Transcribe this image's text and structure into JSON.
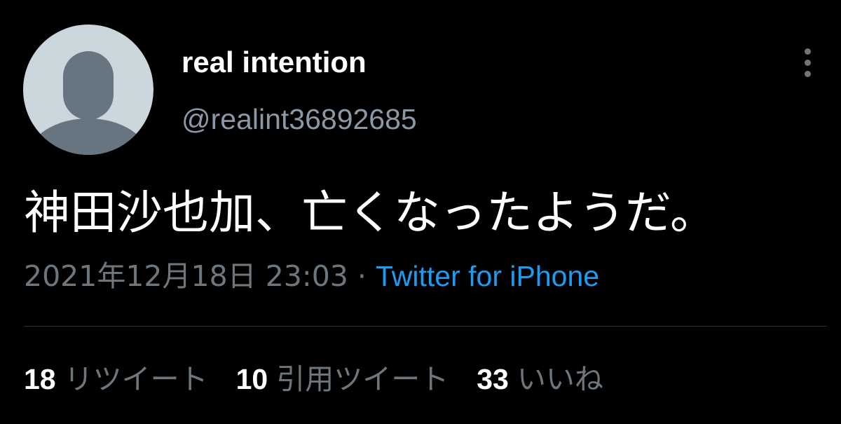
{
  "user": {
    "display_name": "real intention",
    "handle": "@realint36892685",
    "avatar_icon": "default-profile-silhouette-icon"
  },
  "tweet": {
    "text": "神田沙也加、亡くなったようだ。",
    "timestamp": "2021年12月18日 23:03",
    "separator": "·",
    "source": "Twitter for iPhone"
  },
  "stats": {
    "retweets": {
      "count": "18",
      "label": "リツイート"
    },
    "quotes": {
      "count": "10",
      "label": "引用ツイート"
    },
    "likes": {
      "count": "33",
      "label": "いいね"
    }
  },
  "colors": {
    "background": "#000000",
    "link": "#1d9bf0",
    "secondary_text": "#6e767d",
    "avatar_bg": "#ccd6dd",
    "avatar_fg": "#66757f"
  }
}
